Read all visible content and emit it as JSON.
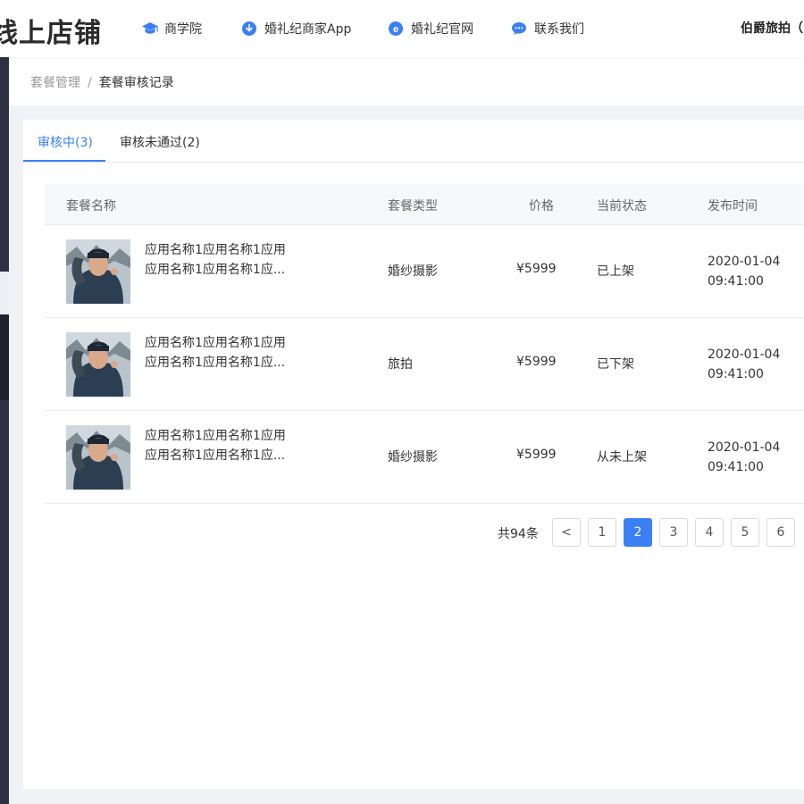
{
  "header": {
    "brand": "线上店铺",
    "nav": [
      {
        "label": "商学院",
        "icon": "graduation-cap-icon"
      },
      {
        "label": "婚礼纪商家App",
        "icon": "download-icon"
      },
      {
        "label": "婚礼纪官网",
        "icon": "ie-browser-icon"
      },
      {
        "label": "联系我们",
        "icon": "chat-bubble-icon"
      }
    ],
    "user": "伯爵旅拍（"
  },
  "breadcrumb": {
    "parent": "套餐管理",
    "separator": "/",
    "current": "套餐审核记录"
  },
  "tabs": [
    {
      "label": "审核中(3)",
      "active": true
    },
    {
      "label": "审核未通过(2)",
      "active": false
    }
  ],
  "table": {
    "columns": [
      "套餐名称",
      "套餐类型",
      "价格",
      "当前状态",
      "发布时间"
    ],
    "rows": [
      {
        "name_line1": "应用名称1应用名称1应用",
        "name_line2": "应用名称1应用名称1应...",
        "type": "婚纱摄影",
        "price": "¥5999",
        "status": "已上架",
        "date": "2020-01-04",
        "time": "09:41:00"
      },
      {
        "name_line1": "应用名称1应用名称1应用",
        "name_line2": "应用名称1应用名称1应...",
        "type": "旅拍",
        "price": "¥5999",
        "status": "已下架",
        "date": "2020-01-04",
        "time": "09:41:00"
      },
      {
        "name_line1": "应用名称1应用名称1应用",
        "name_line2": "应用名称1应用名称1应...",
        "type": "婚纱摄影",
        "price": "¥5999",
        "status": "从未上架",
        "date": "2020-01-04",
        "time": "09:41:00"
      }
    ]
  },
  "pagination": {
    "total": "共94条",
    "prev": "<",
    "pages": [
      "1",
      "2",
      "3",
      "4",
      "5",
      "6"
    ],
    "current": "2"
  },
  "colors": {
    "accent": "#3b7ff5",
    "sidebar": "#2f3142"
  }
}
